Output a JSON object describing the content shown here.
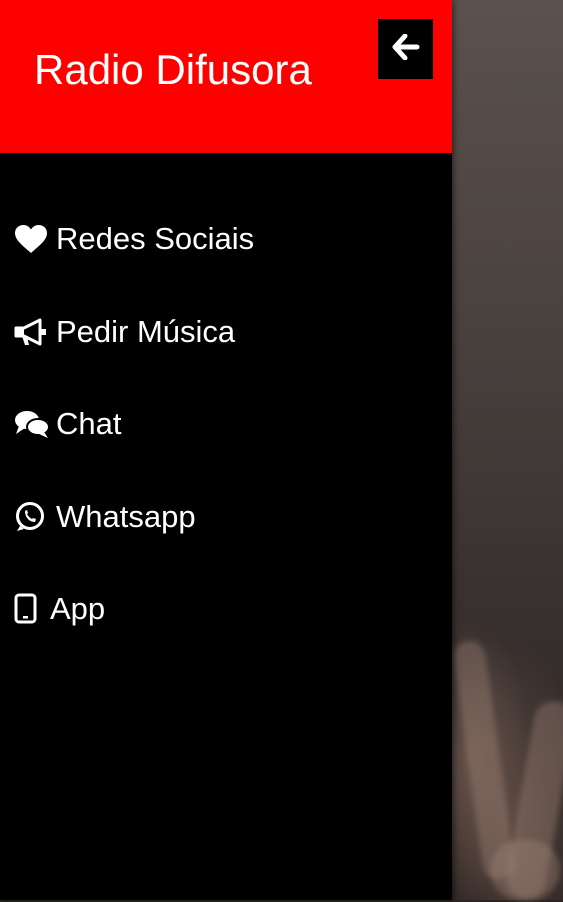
{
  "drawer": {
    "title": "Radio Difusora",
    "colors": {
      "header": "#ff0000",
      "panel": "#000000",
      "text": "#ffffff"
    },
    "close_icon": "arrow-left-icon"
  },
  "menu": [
    {
      "label": "Redes Sociais",
      "icon": "heart-icon"
    },
    {
      "label": "Pedir Música",
      "icon": "megaphone-icon"
    },
    {
      "label": "Chat",
      "icon": "chat-bubbles-icon"
    },
    {
      "label": "Whatsapp",
      "icon": "whatsapp-icon"
    },
    {
      "label": "App",
      "icon": "tablet-icon"
    }
  ]
}
